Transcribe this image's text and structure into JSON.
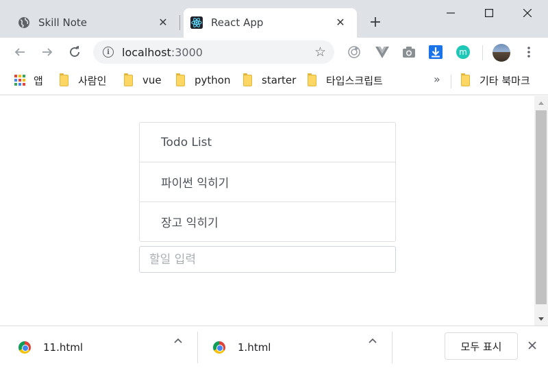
{
  "browser": {
    "tabs": [
      {
        "title": "Skill Note",
        "active": false,
        "icon": "globe-icon"
      },
      {
        "title": "React App",
        "active": true,
        "icon": "react-logo-icon"
      }
    ],
    "new_tab_symbol": "+",
    "address": {
      "host": "localhost",
      "port": ":3000"
    },
    "bookmarks": {
      "apps_label": "앱",
      "items": [
        "사람인",
        "vue",
        "python",
        "starter",
        "타입스크립트"
      ],
      "overflow_symbol": "»",
      "other_bookmarks": "기타 북마크"
    },
    "extensions": [
      "vuejs-extension-icon",
      "camera-extension-icon",
      "download-extension-icon",
      "m-extension-icon"
    ],
    "extension_m_label": "m"
  },
  "page": {
    "todos": [
      "Todo List",
      "파이썬 익히기",
      "장고 익히기"
    ],
    "input": {
      "placeholder": "할일 입력",
      "value": ""
    }
  },
  "downloads": {
    "items": [
      {
        "name": "11.html"
      },
      {
        "name": "1.html"
      }
    ],
    "show_all_label": "모두 표시"
  },
  "colors": {
    "titlebar": "#dee1e6",
    "omnibox": "#f1f3f4",
    "folder": "#fdd663",
    "react": "#61dafb"
  }
}
